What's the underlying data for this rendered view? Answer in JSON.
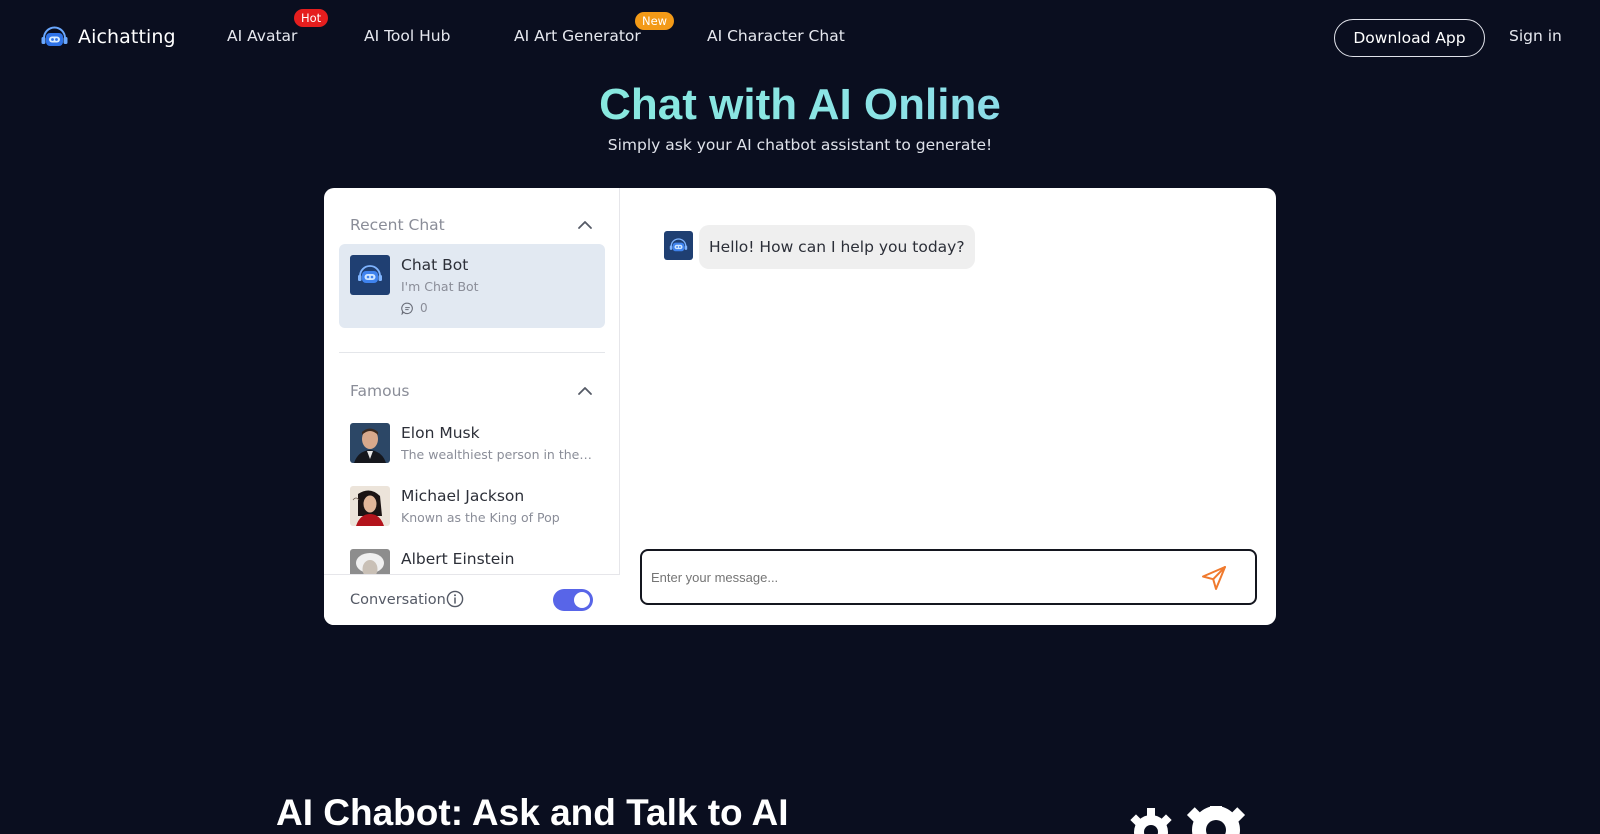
{
  "nav": {
    "brand": "Aichatting",
    "links": [
      {
        "label": "AI Avatar",
        "badge": "Hot"
      },
      {
        "label": "AI Tool Hub",
        "badge": ""
      },
      {
        "label": "AI Art Generator",
        "badge": "New"
      },
      {
        "label": "AI Character Chat",
        "badge": ""
      }
    ],
    "download": "Download App",
    "signin": "Sign in"
  },
  "hero": {
    "title": "Chat with AI Online",
    "subtitle": "Simply ask your AI chatbot assistant to generate!"
  },
  "sidebar": {
    "recent_title": "Recent Chat",
    "recent": [
      {
        "name": "Chat Bot",
        "desc": "I'm Chat Bot",
        "count": "0"
      }
    ],
    "famous_title": "Famous",
    "famous": [
      {
        "name": "Elon Musk",
        "desc": "The wealthiest person in the world"
      },
      {
        "name": "Michael Jackson",
        "desc": "Known as the King of Pop"
      },
      {
        "name": "Albert Einstein",
        "desc": ""
      }
    ],
    "conversation_label": "Conversation",
    "conversation_on": true
  },
  "chat": {
    "greeting": "Hello! How can I help you today?",
    "input_placeholder": "Enter your message..."
  },
  "below": {
    "section_title": "AI Chabot: Ask and Talk to AI"
  },
  "colors": {
    "background": "#0a0e1f",
    "accent": "#5865e8",
    "send": "#f07a2e",
    "hot_badge": "#e51e1e",
    "new_badge": "#f39a17"
  }
}
